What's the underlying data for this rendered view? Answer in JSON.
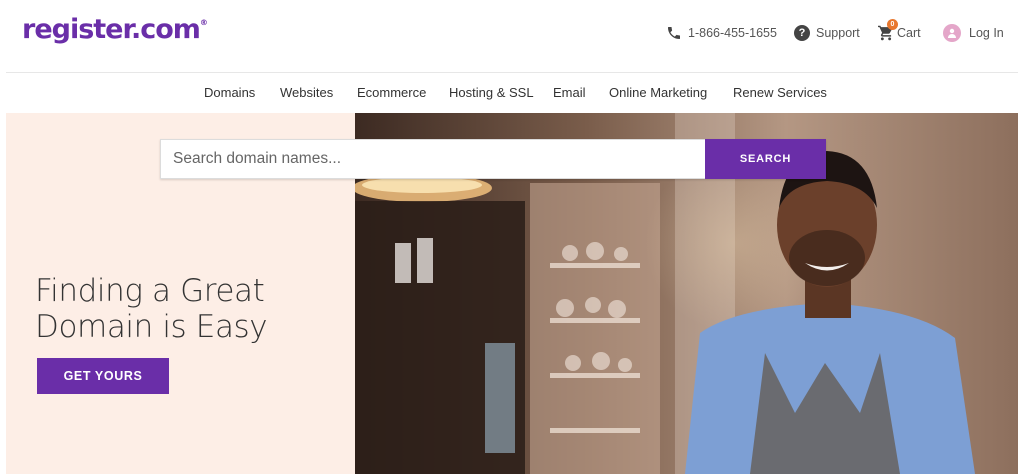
{
  "brand": {
    "name": "register.com",
    "registered_mark": "®",
    "color": "#6a2ea8"
  },
  "utility": {
    "phone": {
      "icon": "phone-icon",
      "label": "1-866-455-1655"
    },
    "support": {
      "icon": "help-circle-icon",
      "label": "Support"
    },
    "cart": {
      "icon": "cart-icon",
      "label": "Cart",
      "count": "0",
      "badge_color": "#e8772e"
    },
    "login": {
      "icon": "user-avatar-icon",
      "label": "Log In"
    }
  },
  "nav": {
    "items": [
      {
        "label": "Domains"
      },
      {
        "label": "Websites"
      },
      {
        "label": "Ecommerce"
      },
      {
        "label": "Hosting & SSL"
      },
      {
        "label": "Email"
      },
      {
        "label": "Online Marketing"
      },
      {
        "label": "Renew Services"
      }
    ]
  },
  "search": {
    "placeholder": "Search domain names...",
    "value": "",
    "button_label": "SEARCH"
  },
  "hero": {
    "headline_line1": "Finding a Great",
    "headline_line2": "Domain is Easy",
    "cta_label": "GET YOURS",
    "background_color": "#fdeee6",
    "photo_subject": "smiling-shop-owner-photo"
  }
}
